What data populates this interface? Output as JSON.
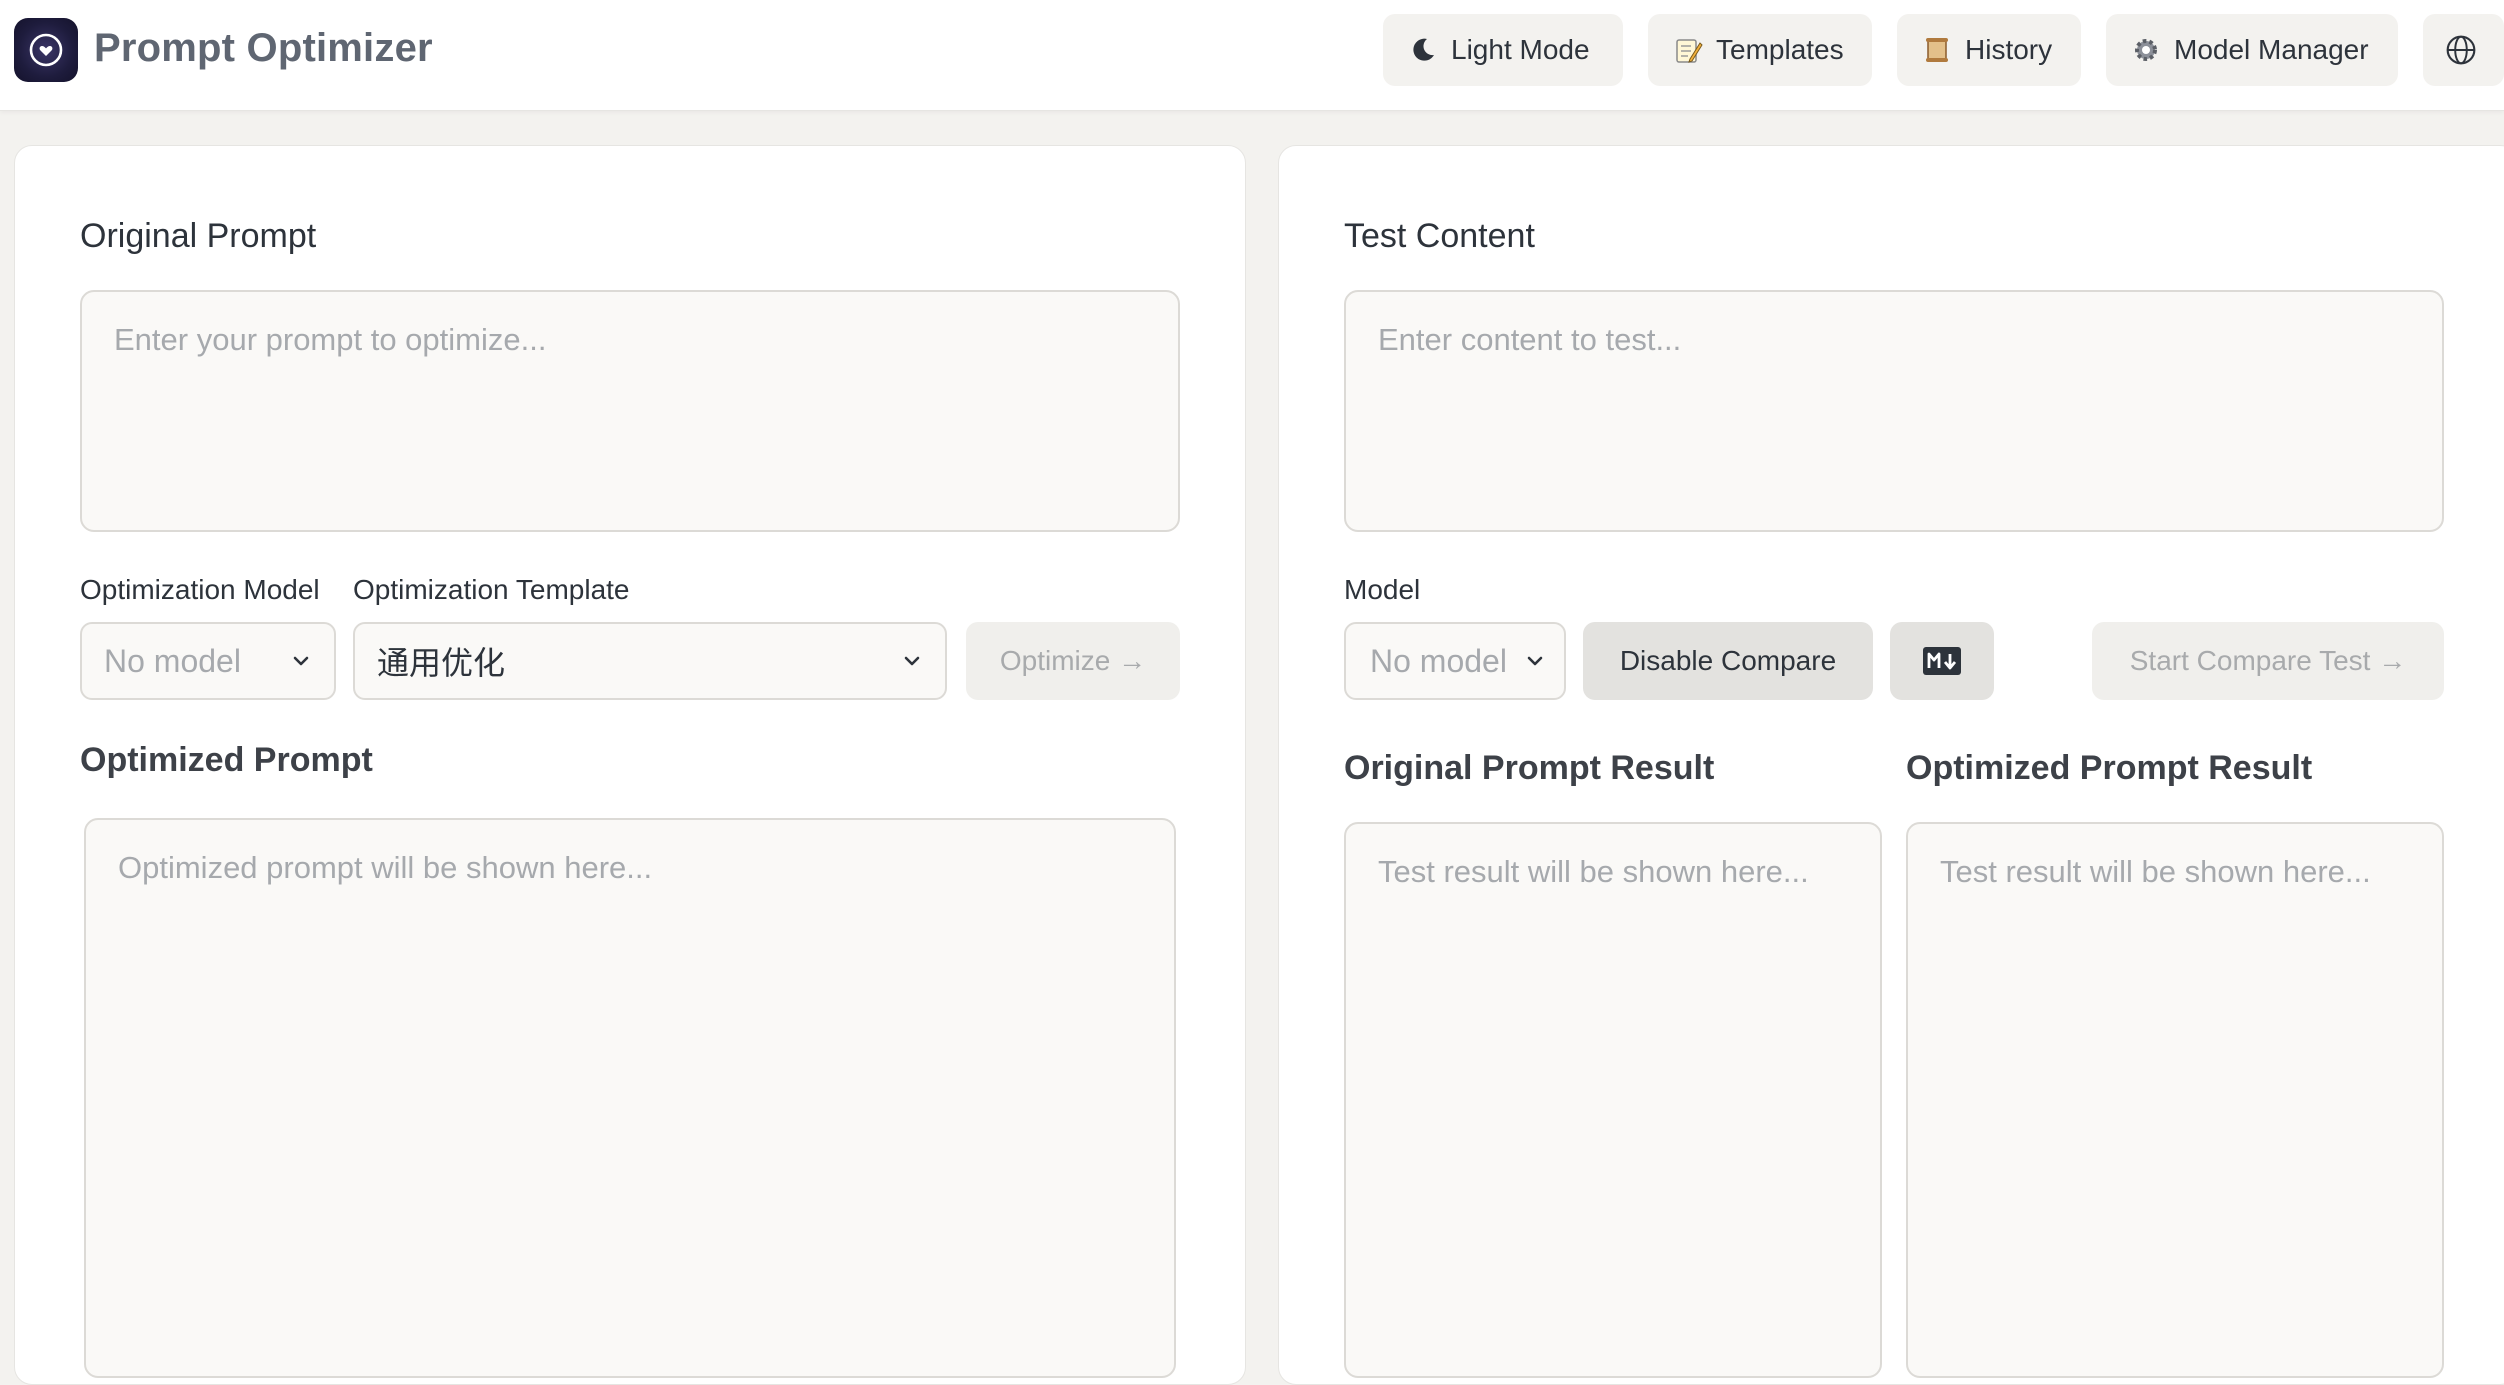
{
  "app": {
    "title": "Prompt Optimizer"
  },
  "header": {
    "buttons": [
      {
        "label": "Light Mode",
        "icon": "moon-icon"
      },
      {
        "label": "Templates",
        "icon": "memo-icon"
      },
      {
        "label": "History",
        "icon": "scroll-icon"
      },
      {
        "label": "Model Manager",
        "icon": "gear-icon"
      }
    ],
    "language_icon": "globe-icon"
  },
  "left": {
    "original_title": "Original Prompt",
    "original_placeholder": "Enter your prompt to optimize...",
    "model_label": "Optimization Model",
    "model_value": "No model",
    "template_label": "Optimization Template",
    "template_value": "通用优化",
    "optimize_label": "Optimize →",
    "optimized_title": "Optimized Prompt",
    "optimized_placeholder": "Optimized prompt will be shown here..."
  },
  "right": {
    "test_title": "Test Content",
    "test_placeholder": "Enter content to test...",
    "model_label": "Model",
    "model_value": "No model",
    "disable_compare_label": "Disable Compare",
    "markdown_toggle_icon": "markdown-icon",
    "start_test_label": "Start Compare Test →",
    "original_result_title": "Original Prompt Result",
    "optimized_result_title": "Optimized Prompt Result",
    "result_placeholder": "Test result will be shown here..."
  },
  "colors": {
    "background": "#f3f2ef",
    "panel": "#ffffff",
    "textbox": "#faf9f7",
    "text": "#2d333b",
    "placeholder": "#a6a9ad",
    "logo": "#1e1c3d"
  }
}
